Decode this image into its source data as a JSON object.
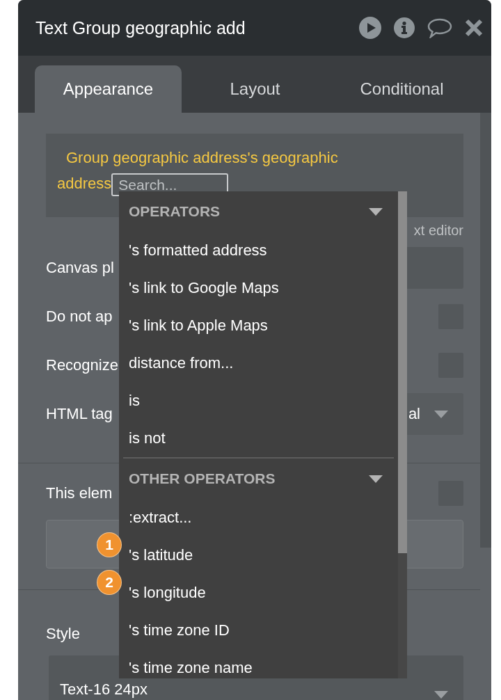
{
  "panel": {
    "title": "Text Group geographic add"
  },
  "tabs": [
    {
      "label": "Appearance",
      "selected": true
    },
    {
      "label": "Layout",
      "selected": false
    },
    {
      "label": "Conditional",
      "selected": false
    }
  ],
  "expression": {
    "text": "Group geographic address's geographic address",
    "search": {
      "placeholder": "Search..."
    }
  },
  "text_editor_link": "xt editor",
  "settings": [
    {
      "kind": "input",
      "label": "Canvas pl"
    },
    {
      "kind": "checkbox",
      "label": "Do not ap",
      "checked": false
    },
    {
      "kind": "checkbox",
      "label": "Recognize",
      "checked": false
    },
    {
      "kind": "select",
      "label": "HTML tag",
      "value": "al"
    }
  ],
  "visibility": {
    "label": "This elem",
    "checked": false
  },
  "style": {
    "label": "Style",
    "value": "Text-16 24px"
  },
  "dropdown": {
    "sections": [
      {
        "title": "OPERATORS",
        "items": [
          {
            "label": "'s formatted address"
          },
          {
            "label": "'s link to Google Maps"
          },
          {
            "label": "'s link to Apple Maps"
          },
          {
            "label": "distance from..."
          },
          {
            "label": "is"
          },
          {
            "label": "is not"
          }
        ]
      },
      {
        "title": "OTHER OPERATORS",
        "items": [
          {
            "label": ":extract..."
          },
          {
            "label": "'s latitude",
            "badge": "1"
          },
          {
            "label": "'s longitude",
            "badge": "2"
          },
          {
            "label": "'s time zone ID"
          },
          {
            "label": "'s time zone name"
          }
        ]
      }
    ]
  }
}
